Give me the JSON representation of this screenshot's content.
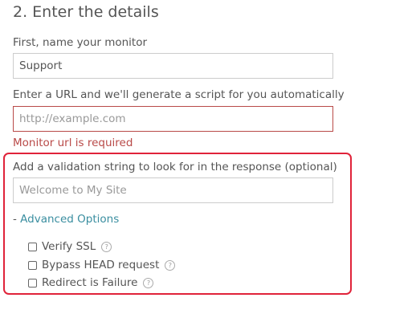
{
  "section": {
    "title": "2. Enter the details"
  },
  "monitor_name": {
    "label": "First, name your monitor",
    "value": "Support"
  },
  "url": {
    "label": "Enter a URL and we'll generate a script for you automatically",
    "placeholder": "http://example.com",
    "error": "Monitor url is required"
  },
  "validation": {
    "label": "Add a validation string to look for in the response (optional)",
    "placeholder": "Welcome to My Site"
  },
  "advanced": {
    "prefix": "-",
    "label": "Advanced Options",
    "options": [
      {
        "label": "Verify SSL",
        "checked": false,
        "help_icon": "question-circle-icon"
      },
      {
        "label": "Bypass HEAD request",
        "checked": false,
        "help_icon": "question-circle-icon"
      },
      {
        "label": "Redirect is Failure",
        "checked": false,
        "help_icon": "question-circle-icon"
      }
    ]
  },
  "colors": {
    "error": "#b94a48",
    "link": "#3a8ea0",
    "highlight": "#e0233a"
  }
}
